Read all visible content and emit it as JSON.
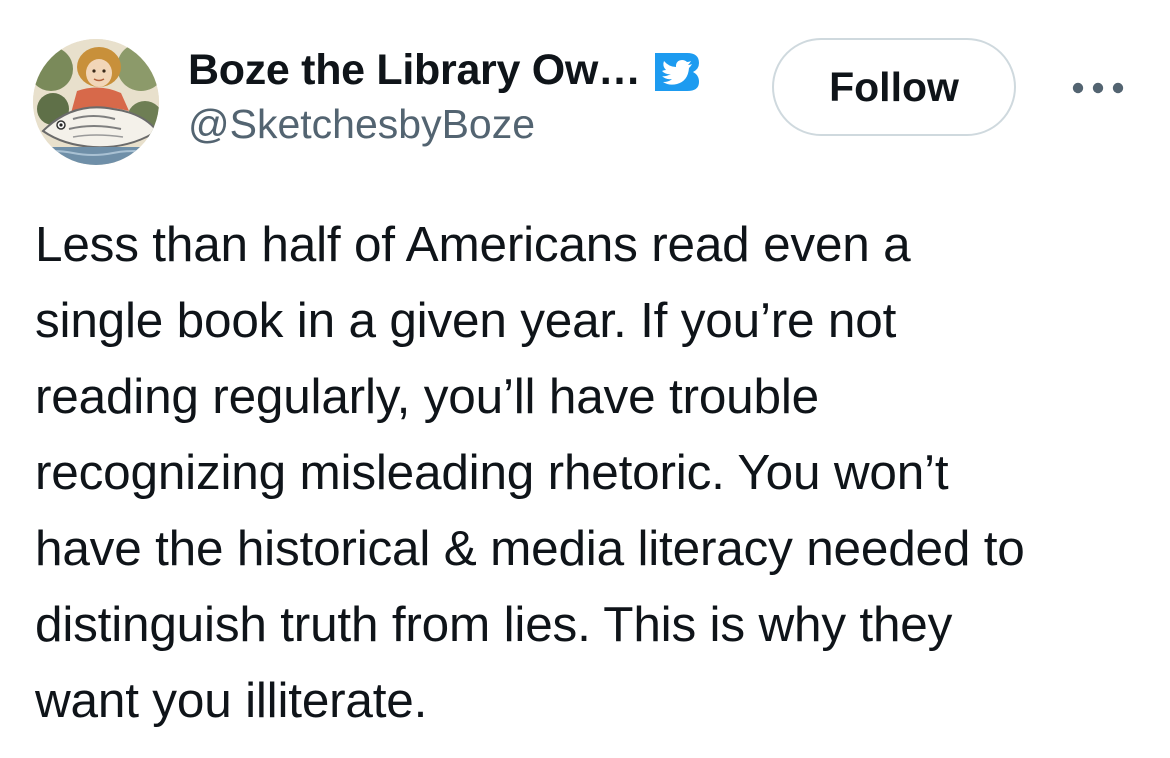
{
  "author": {
    "display_name": "Boze the Library Ow…",
    "handle": "@SketchesbyBoze",
    "avatar_icon": "illustrated-portrait-avatar",
    "verified_icon": "twitter-blue-verified-badge-icon"
  },
  "actions": {
    "follow_label": "Follow",
    "more_icon": "more-dots-icon"
  },
  "tweet": {
    "lines": [
      "Less than half of Americans read even a",
      "single book in a given year. If you’re not",
      "reading regularly, you’ll have trouble",
      "recognizing misleading rhetoric. You won’t",
      "have the historical & media literacy needed to",
      "distinguish truth from lies. This is why they",
      "want you illiterate."
    ]
  },
  "colors": {
    "text_primary": "#0f1419",
    "text_secondary": "#536471",
    "brand_blue": "#1d9bf0",
    "border": "#cfd9de"
  }
}
